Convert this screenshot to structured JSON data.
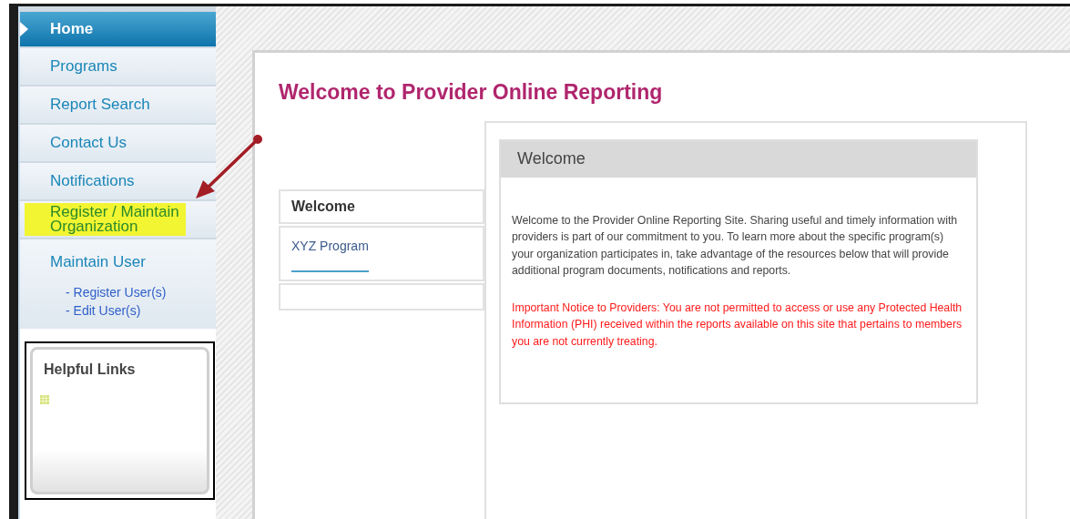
{
  "nav": [
    {
      "label": "Home",
      "selected": true,
      "highlighted": false
    },
    {
      "label": "Programs",
      "selected": false,
      "highlighted": false
    },
    {
      "label": "Report Search",
      "selected": false,
      "highlighted": false
    },
    {
      "label": "Contact Us",
      "selected": false,
      "highlighted": false
    },
    {
      "label": "Notifications",
      "selected": false,
      "highlighted": false
    },
    {
      "label": "Register / Maintain Organization",
      "selected": false,
      "highlighted": true
    },
    {
      "label": "Maintain User",
      "selected": false,
      "highlighted": false,
      "children": [
        {
          "label": "- Register User(s)"
        },
        {
          "label": "- Edit User(s)"
        }
      ]
    }
  ],
  "helpful_links": {
    "title": "Helpful Links"
  },
  "page_title": "Welcome to Provider Online Reporting",
  "programs_table": {
    "header": "Welcome",
    "rows": [
      {
        "label": "XYZ Program"
      }
    ]
  },
  "welcome_panel": {
    "title": "Welcome",
    "intro": "Welcome to the Provider Online Reporting Site. Sharing useful and timely information with providers is part of our commitment to you. To learn more about the specific program(s) your organization participates in, take advantage of the resources below that will provide additional program documents, notifications and reports.",
    "notice": "Important Notice to Providers: You are not permitted to access or use any Protected Health Information (PHI) received within the reports available on this site that pertains to members you are not currently treating."
  }
}
